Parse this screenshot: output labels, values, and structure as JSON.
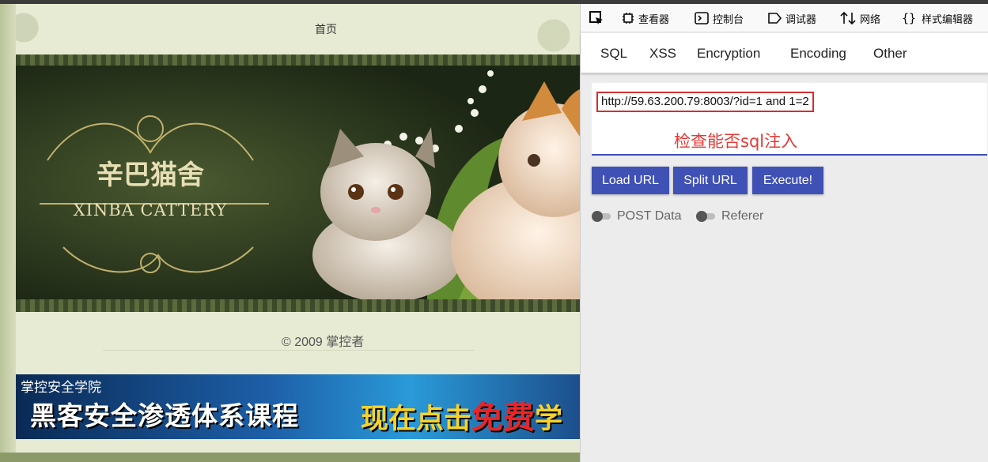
{
  "page": {
    "nav_home": "首页",
    "banner": {
      "title_cn": "辛巴猫舍",
      "title_en": "XINBA CATTERY"
    },
    "footer_copyright": "© 2009 掌控者",
    "ad": {
      "school": "掌控安全学院",
      "headline": "黑客安全渗透体系课程",
      "cta_prefix": "现在点击",
      "cta_free": "免费",
      "cta_suffix": "学"
    }
  },
  "devtools": {
    "toolbar": {
      "inspector": "查看器",
      "console": "控制台",
      "debugger": "调试器",
      "network": "网络",
      "style_editor": "样式编辑器"
    },
    "hackbar": {
      "tabs": [
        "SQL",
        "XSS",
        "Encryption",
        "Encoding",
        "Other"
      ],
      "url_value": "http://59.63.200.79:8003/?id=1 and 1=2",
      "annotation": "检查能否sql注入",
      "buttons": {
        "load": "Load URL",
        "split": "Split URL",
        "execute": "Execute!"
      },
      "toggles": {
        "post_data": "POST Data",
        "referer": "Referer"
      },
      "accent_color": "#3f51b5",
      "annotation_color": "#e53935"
    }
  }
}
